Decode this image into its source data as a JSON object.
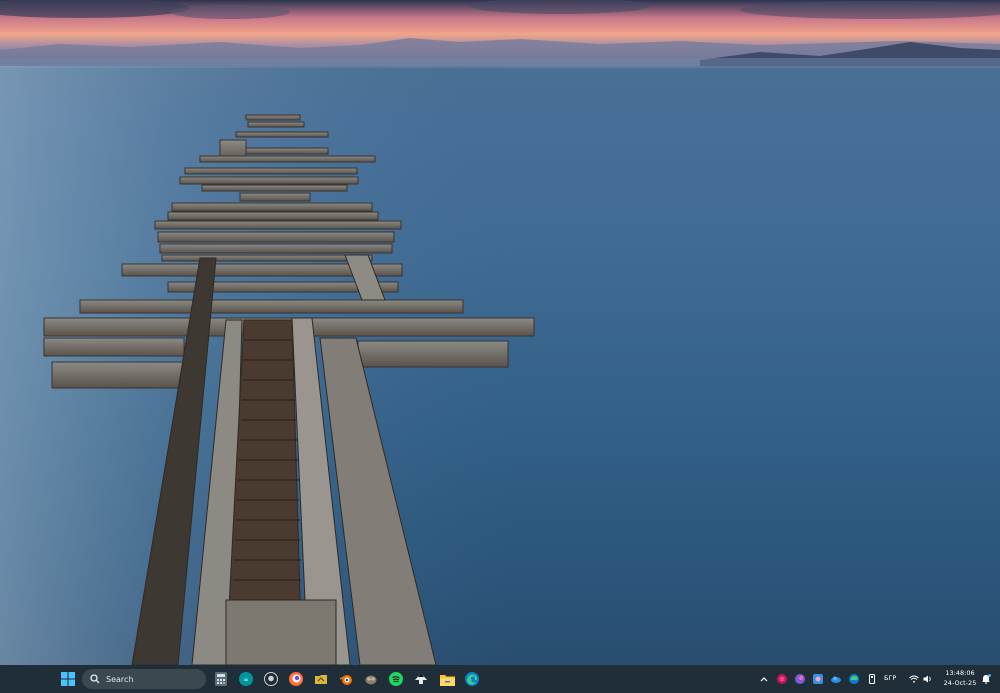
{
  "desktop": {
    "wallpaper": "wooden-pier-lake-sunset"
  },
  "taskbar": {
    "search_label": "Search",
    "pinned_apps": [
      "start-icon",
      "calculator-icon",
      "arduino-icon",
      "github-icon",
      "firefox-icon",
      "folder-app-icon",
      "blender-icon",
      "gimp-icon",
      "spotify-icon",
      "inkscape-icon",
      "file-explorer-icon",
      "edge-icon"
    ],
    "tray": {
      "language": "БГР",
      "time": "13:48:06",
      "date": "24-Oct-25"
    },
    "colors": {
      "taskbar_bg": "#1f2e38",
      "accent": "#4cc2ff"
    }
  }
}
